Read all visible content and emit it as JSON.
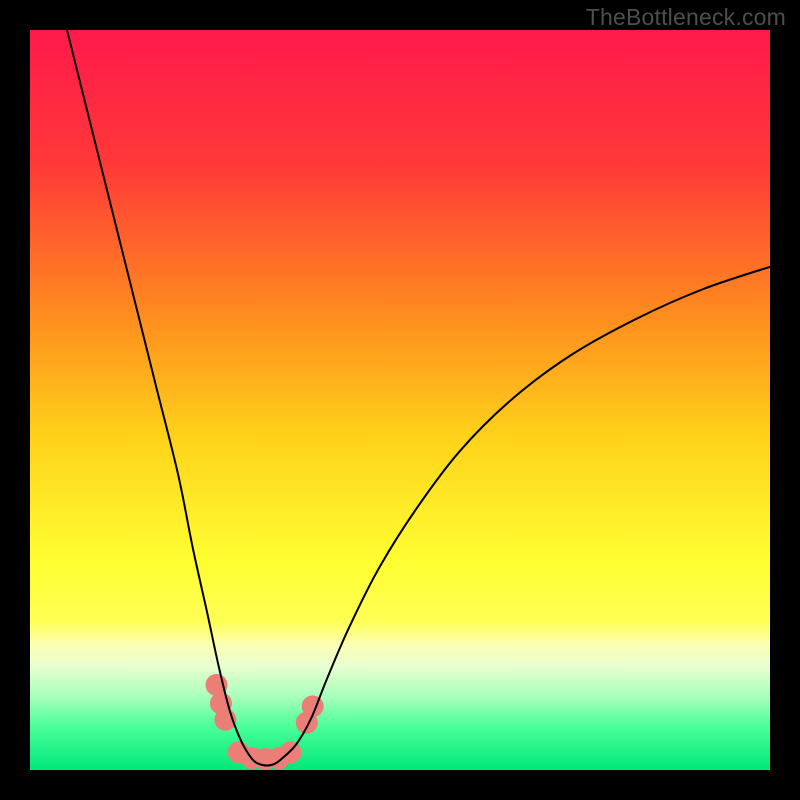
{
  "watermark": "TheBottleneck.com",
  "chart_data": {
    "type": "line",
    "title": "",
    "xlabel": "",
    "ylabel": "",
    "xlim": [
      0,
      100
    ],
    "ylim": [
      0,
      100
    ],
    "background_gradient_stops": [
      {
        "offset": 0,
        "color": "#ff1a4b"
      },
      {
        "offset": 18,
        "color": "#ff3838"
      },
      {
        "offset": 38,
        "color": "#ff8a1f"
      },
      {
        "offset": 55,
        "color": "#ffd21a"
      },
      {
        "offset": 72,
        "color": "#ffff33"
      },
      {
        "offset": 80,
        "color": "#ffff55"
      },
      {
        "offset": 83,
        "color": "#fcffb3"
      },
      {
        "offset": 86,
        "color": "#e8ffd0"
      },
      {
        "offset": 90,
        "color": "#aaffbc"
      },
      {
        "offset": 94,
        "color": "#4dff9a"
      },
      {
        "offset": 100,
        "color": "#00e87a"
      }
    ],
    "series": [
      {
        "name": "bottleneck-curve",
        "color": "#000000",
        "width": 2,
        "x": [
          5,
          8,
          11,
          14,
          17,
          20,
          22,
          24,
          25.5,
          27,
          28.5,
          30,
          31,
          32,
          33,
          34,
          36,
          38,
          40,
          43,
          47,
          52,
          58,
          65,
          73,
          82,
          91,
          100
        ],
        "y": [
          100,
          88,
          76,
          64,
          52,
          40,
          30,
          21,
          14,
          8,
          4,
          1.5,
          0.8,
          0.6,
          0.8,
          1.5,
          3.5,
          7,
          12,
          19,
          27,
          35,
          43,
          50,
          56,
          61,
          65,
          68
        ]
      }
    ],
    "markers": {
      "name": "bottleneck-dots",
      "color": "#eb7f78",
      "radius": 11,
      "points": [
        {
          "x": 25.2,
          "y": 11.5
        },
        {
          "x": 25.8,
          "y": 9.0
        },
        {
          "x": 26.4,
          "y": 6.8
        },
        {
          "x": 28.2,
          "y": 2.4
        },
        {
          "x": 30.0,
          "y": 1.6
        },
        {
          "x": 31.8,
          "y": 1.5
        },
        {
          "x": 33.6,
          "y": 1.6
        },
        {
          "x": 35.2,
          "y": 2.4
        },
        {
          "x": 37.4,
          "y": 6.4
        },
        {
          "x": 38.2,
          "y": 8.6
        }
      ]
    }
  }
}
